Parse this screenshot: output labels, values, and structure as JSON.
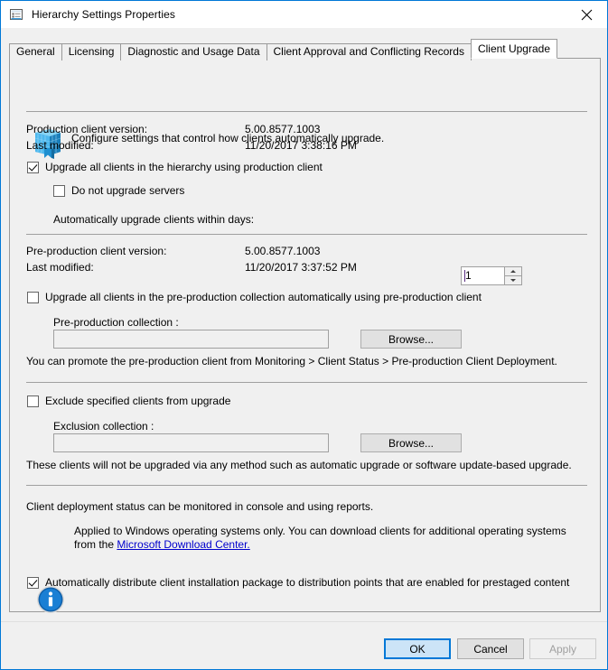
{
  "window": {
    "title": "Hierarchy Settings Properties",
    "icon": "window-form-icon",
    "close_glyph": "✕",
    "accent_color": "#0078d7"
  },
  "tabs": [
    {
      "label": "General",
      "selected": false
    },
    {
      "label": "Licensing",
      "selected": false
    },
    {
      "label": "Diagnostic and Usage Data",
      "selected": false
    },
    {
      "label": "Client Approval and Conflicting Records",
      "selected": false
    },
    {
      "label": "Client Upgrade",
      "selected": true
    }
  ],
  "page": {
    "header_icon": "client-package-icon",
    "header_text": "Configure settings that control how clients automatically upgrade.",
    "production": {
      "version_label": "Production client version:",
      "version_value": "5.00.8577.1003",
      "modified_label": "Last modified:",
      "modified_value": "11/20/2017 3:38:16 PM",
      "upgrade_all_label": "Upgrade all clients in the hierarchy using production client",
      "upgrade_all_checked": true,
      "no_servers_label": "Do not upgrade servers",
      "no_servers_checked": false,
      "days_label": "Automatically upgrade clients within days:",
      "days_value": "1"
    },
    "preproduction": {
      "version_label": "Pre-production client version:",
      "version_value": "5.00.8577.1003",
      "modified_label": "Last modified:",
      "modified_value": "11/20/2017 3:37:52 PM",
      "upgrade_label": "Upgrade all clients in the pre-production collection automatically using pre-production client",
      "upgrade_checked": false,
      "collection_label": "Pre-production collection :",
      "collection_value": "",
      "browse_label": "Browse...",
      "hint": "You can promote the pre-production client from Monitoring > Client Status > Pre-production Client Deployment."
    },
    "exclusion": {
      "exclude_label": "Exclude specified clients from upgrade",
      "exclude_checked": false,
      "collection_label": "Exclusion collection :",
      "collection_value": "",
      "browse_label": "Browse...",
      "hint": "These clients will not be upgraded via any method such as automatic upgrade or software update-based upgrade."
    },
    "status": {
      "text": "Client deployment status can be monitored in console and using reports.",
      "info_icon": "information-icon",
      "info_text_before": "Applied to Windows operating systems only. You can download clients for additional operating systems from the ",
      "info_link": "Microsoft Download Center.",
      "distribute_label": "Automatically distribute client installation package to distribution points that are enabled for prestaged content",
      "distribute_checked": true
    }
  },
  "footer": {
    "ok_label": "OK",
    "cancel_label": "Cancel",
    "apply_label": "Apply",
    "apply_disabled": true
  }
}
